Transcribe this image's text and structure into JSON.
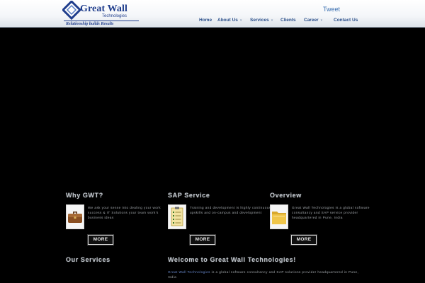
{
  "header": {
    "logo": {
      "title": "Great Wall",
      "subtitle": "Technologies",
      "tagline": "Relationship builds Results",
      "icon": "diamond-logo-icon"
    },
    "tweet_label": "Tweet",
    "nav": [
      {
        "label": "Home",
        "has_dropdown": false
      },
      {
        "label": "About Us",
        "has_dropdown": true
      },
      {
        "label": "Services",
        "has_dropdown": true
      },
      {
        "label": "Clients",
        "has_dropdown": false
      },
      {
        "label": "Career",
        "has_dropdown": true
      },
      {
        "label": "Contact Us",
        "has_dropdown": false
      }
    ],
    "caret": "▾"
  },
  "blocks": [
    {
      "heading": "Why GWT?",
      "icon": "briefcase-icon",
      "text": "We ask your sense into dealing your work success & IT Solutions your team work's business ideas",
      "more_label": "MORE"
    },
    {
      "heading": "SAP Service",
      "icon": "checklist-icon",
      "text": "Training and development is highly continuous upskills and on-campus and development",
      "more_label": "MORE"
    },
    {
      "heading": "Overview",
      "icon": "folder-icon",
      "text": "Great Wall Technologies is a global software consultancy and SAP service provider headquartered in Pune, India",
      "more_label": "MORE"
    }
  ],
  "our_services": {
    "heading": "Our Services"
  },
  "welcome": {
    "heading": "Welcome to Great Wall Technologies!",
    "link_text": "Great Wall Technologies",
    "text": " is a global software consultancy and SAP solutions provider headquartered in Pune, India"
  },
  "colors": {
    "header_bg": "#f4f6f9",
    "nav_text": "#2b4f8a",
    "brand": "#1f3d8c",
    "page_bg": "#000000"
  }
}
